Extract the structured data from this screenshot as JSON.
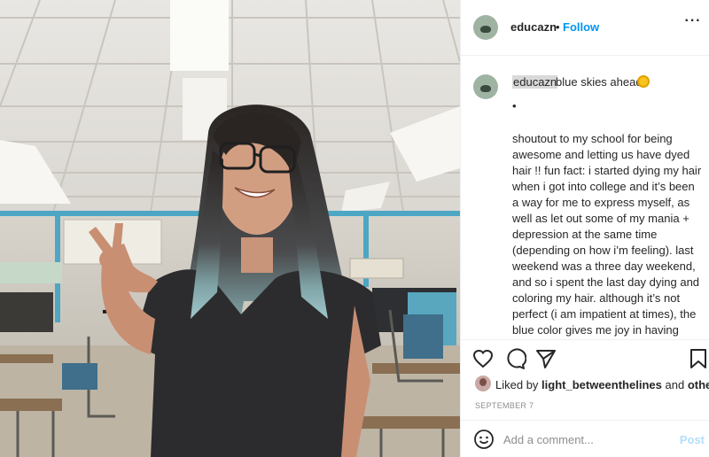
{
  "post": {
    "username": "educazn",
    "follow_dot": "•",
    "follow_label": "Follow",
    "more_label": "···",
    "caption_user": "educazn",
    "caption_first_line": "blue skies ahead",
    "caption_bullet": "•",
    "caption_body": "shoutout to my school for being awesome and letting us have dyed hair !! fun fact: i started dying my hair when i got into college and it’s been a way for me to express myself, as well as let out some of my mania + depression at the same time (depending on how i’m feeling). last weekend was a three day weekend, and so i spent the last day dying and coloring my hair. although it’s not perfect (i am impatient at times), the blue color gives me joy in having something different. definitely had the kiddos shocked when they came to",
    "liked_prefix": "Liked by",
    "liked_user": "light_betweenthelines",
    "liked_and": "and",
    "liked_others": "others",
    "date": "SEPTEMBER 7",
    "comment_placeholder": "Add a comment...",
    "post_label": "Post"
  },
  "icons": {
    "like": "heart-icon",
    "comment": "comment-icon",
    "share": "paper-plane-icon",
    "save": "bookmark-icon",
    "emoji": "smiley-icon",
    "sun_emoji": "sun-emoji-icon"
  },
  "colors": {
    "follow": "#0095f6",
    "post_disabled": "#b2dffc",
    "meta_text": "#8e8e8e",
    "border": "#efefef"
  }
}
